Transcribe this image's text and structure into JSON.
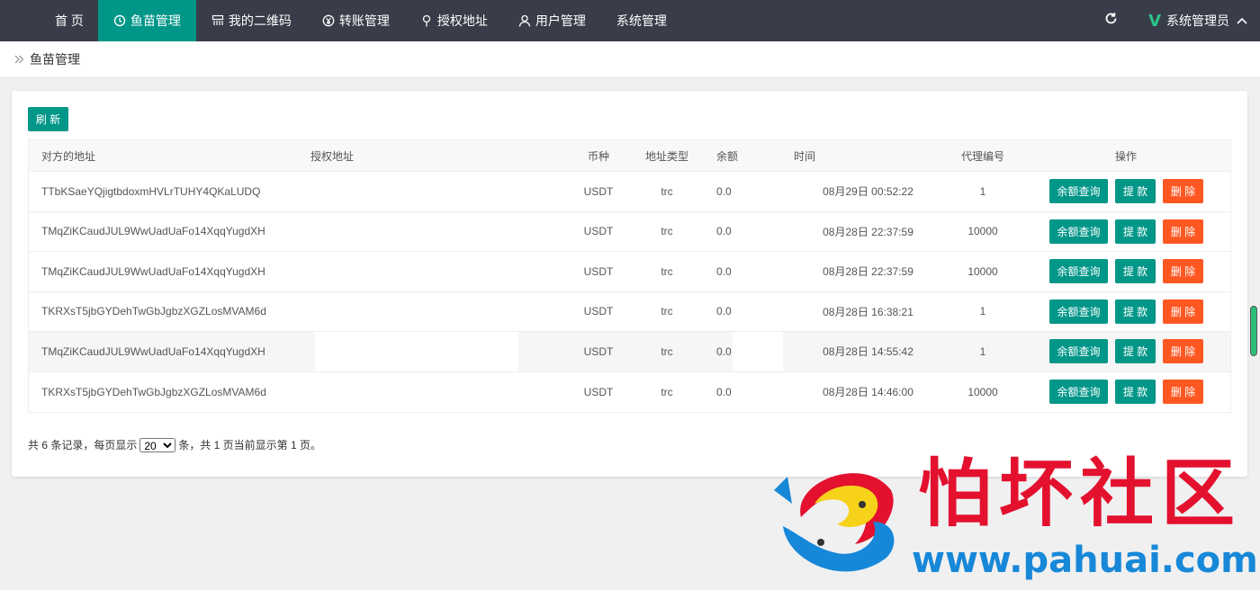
{
  "nav": {
    "items": [
      {
        "label": "首 页",
        "icon": "",
        "active": false
      },
      {
        "label": "鱼苗管理",
        "icon": "clock-icon",
        "active": true
      },
      {
        "label": "我的二维码",
        "icon": "qrcode-icon",
        "active": false
      },
      {
        "label": "转账管理",
        "icon": "yen-icon",
        "active": false
      },
      {
        "label": "授权地址",
        "icon": "location-pin-icon",
        "active": false
      },
      {
        "label": "用户管理",
        "icon": "user-icon",
        "active": false
      },
      {
        "label": "系统管理",
        "icon": "",
        "active": false
      }
    ],
    "user_label": "系统管理员",
    "refresh_icon": "refresh-icon",
    "accent": "#009688",
    "bar_color": "#393d49"
  },
  "breadcrumb": {
    "current": "鱼苗管理"
  },
  "toolbar": {
    "refresh_label": "刷 新"
  },
  "table": {
    "headers": {
      "peer": "对方的地址",
      "auth": "授权地址",
      "coin": "币种",
      "type": "地址类型",
      "balance": "余额",
      "time": "时间",
      "agent": "代理编号",
      "ops": "操作"
    },
    "rows": [
      {
        "peer": "TTbKSaeYQjigtbdoxmHVLrTUHY4QKaLUDQ",
        "coin": "USDT",
        "type": "trc",
        "balance": "0.0",
        "time": "08月29日 00:52:22",
        "agent": "1"
      },
      {
        "peer": "TMqZiKCaudJUL9WwUadUaFo14XqqYugdXH",
        "coin": "USDT",
        "type": "trc",
        "balance": "0.0",
        "time": "08月28日 22:37:59",
        "agent": "10000"
      },
      {
        "peer": "TMqZiKCaudJUL9WwUadUaFo14XqqYugdXH",
        "coin": "USDT",
        "type": "trc",
        "balance": "0.0",
        "time": "08月28日 22:37:59",
        "agent": "10000"
      },
      {
        "peer": "TKRXsT5jbGYDehTwGbJgbzXGZLosMVAM6d",
        "coin": "USDT",
        "type": "trc",
        "balance": "0.0",
        "time": "08月28日 16:38:21",
        "agent": "1"
      },
      {
        "peer": "TMqZiKCaudJUL9WwUadUaFo14XqqYugdXH",
        "coin": "USDT",
        "type": "trc",
        "balance": "0.0",
        "time": "08月28日 14:55:42",
        "agent": "1"
      },
      {
        "peer": "TKRXsT5jbGYDehTwGbJgbzXGZLosMVAM6d",
        "coin": "USDT",
        "type": "trc",
        "balance": "0.0",
        "time": "08月28日 14:46:00",
        "agent": "10000"
      }
    ],
    "actions": {
      "query": "余额查询",
      "withdraw": "提 款",
      "delete": "删 除"
    }
  },
  "pager": {
    "prefix": "共 6 条记录，每页显示",
    "page_size": "20",
    "suffix": "条，共 1 页当前显示第 1 页。"
  },
  "watermark": {
    "title": "怕坏社区",
    "url": "www.pahuai.com"
  }
}
